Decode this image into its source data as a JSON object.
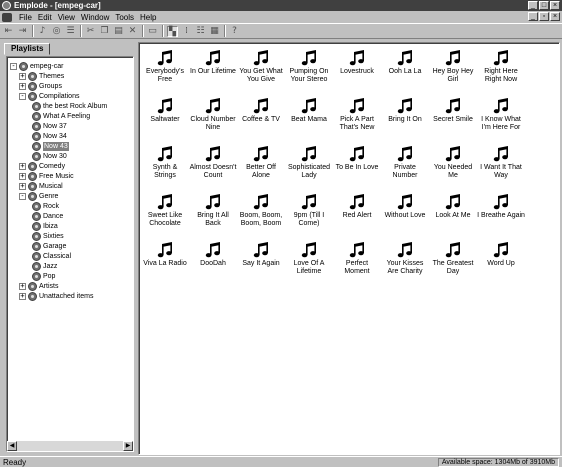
{
  "window": {
    "title": "Emplode - [empeg-car]",
    "icon": "emplode-app-icon",
    "controls": [
      "minimize",
      "maximize",
      "close"
    ]
  },
  "menubar": {
    "items": [
      "File",
      "Edit",
      "View",
      "Window",
      "Tools",
      "Help"
    ]
  },
  "toolbar": {
    "buttons": [
      "disconnect-icon",
      "connect-icon",
      "new-playlist-icon",
      "find-icon",
      "properties-icon",
      "cut-icon",
      "copy-icon",
      "paste-icon",
      "delete-icon",
      "view-toggle-icon",
      "large-icons-icon",
      "small-icons-icon",
      "list-icon",
      "details-icon",
      "help-icon"
    ]
  },
  "left_panel": {
    "tab_label": "Playlists",
    "tree": [
      {
        "label": "empeg-car",
        "level": 0,
        "expander": "-"
      },
      {
        "label": "Themes",
        "level": 1,
        "expander": "+"
      },
      {
        "label": "Groups",
        "level": 1,
        "expander": "+"
      },
      {
        "label": "Compilations",
        "level": 1,
        "expander": "-"
      },
      {
        "label": "the best Rock Album",
        "level": 2,
        "expander": ""
      },
      {
        "label": "What A Feeling",
        "level": 2,
        "expander": ""
      },
      {
        "label": "Now 37",
        "level": 2,
        "expander": ""
      },
      {
        "label": "Now 34",
        "level": 2,
        "expander": ""
      },
      {
        "label": "Now 43",
        "level": 2,
        "expander": "",
        "selected": true
      },
      {
        "label": "Now 30",
        "level": 2,
        "expander": ""
      },
      {
        "label": "Comedy",
        "level": 1,
        "expander": "+"
      },
      {
        "label": "Free Music",
        "level": 1,
        "expander": "+"
      },
      {
        "label": "Musical",
        "level": 1,
        "expander": "+"
      },
      {
        "label": "Genre",
        "level": 1,
        "expander": "-"
      },
      {
        "label": "Rock",
        "level": 2,
        "expander": ""
      },
      {
        "label": "Dance",
        "level": 2,
        "expander": ""
      },
      {
        "label": "Ibiza",
        "level": 2,
        "expander": ""
      },
      {
        "label": "Sixties",
        "level": 2,
        "expander": ""
      },
      {
        "label": "Garage",
        "level": 2,
        "expander": ""
      },
      {
        "label": "Classical",
        "level": 2,
        "expander": ""
      },
      {
        "label": "Jazz",
        "level": 2,
        "expander": ""
      },
      {
        "label": "Pop",
        "level": 2,
        "expander": ""
      },
      {
        "label": "Artists",
        "level": 1,
        "expander": "+"
      },
      {
        "label": "Unattached items",
        "level": 1,
        "expander": "+"
      }
    ]
  },
  "tracks": [
    [
      "Everybody's Free",
      "In Our Lifetime",
      "You Get What You Give",
      "Pumping On Your Stereo",
      "Lovestruck",
      "Ooh La La",
      "Hey Boy Hey Girl",
      "Right Here Right Now"
    ],
    [
      "Saltwater",
      "Cloud Number Nine",
      "Coffee & TV",
      "Beat Mama",
      "Pick A Part That's New",
      "Bring It On",
      "Secret Smile",
      "I Know What I'm Here For"
    ],
    [
      "Synth & Strings",
      "Almost Doesn't Count",
      "Better Off Alone",
      "Sophisticated Lady",
      "To Be In Love",
      "Private Number",
      "You Needed Me",
      "I Want It That Way"
    ],
    [
      "Sweet Like Chocolate",
      "Bring It All Back",
      "Boom, Boom, Boom, Boom",
      "9pm (Till I Come)",
      "Red Alert",
      "Without Love",
      "Look At Me",
      "I Breathe Again"
    ],
    [
      "Viva La Radio",
      "DooDah",
      "Say It Again",
      "Love Of A Lifetime",
      "Perfect Moment",
      "Your Kisses Are Charity",
      "The Greatest Day",
      "Word Up"
    ]
  ],
  "track_icon": "music-note-icon",
  "status": {
    "left": "Ready",
    "right": "Available space: 1304Mb of 3910Mb"
  }
}
